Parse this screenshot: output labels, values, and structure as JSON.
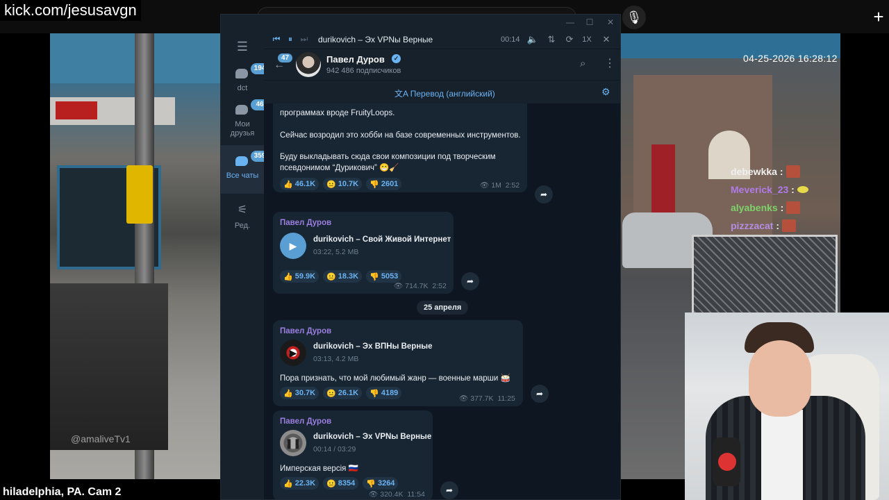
{
  "stream": {
    "url": "kick.com/jesusavgn",
    "cam_timestamp": "04-25-2026 16:28:12",
    "cam_caption": "hiladelphia, PA. Cam 2",
    "watermark": "@amaliveTv1",
    "chat": [
      {
        "user": "debewkka",
        "color": "#f0f0f0"
      },
      {
        "user": "Meverick_23",
        "color": "#b07be8"
      },
      {
        "user": "alyabenks",
        "color": "#7cd36a"
      },
      {
        "user": "pizzzacat",
        "color": "#b28fe3"
      }
    ]
  },
  "telegram": {
    "folders": [
      {
        "label": "dct",
        "badge": "194",
        "active": false
      },
      {
        "label": "Мои друзья",
        "badge": "46",
        "active": false
      },
      {
        "label": "Все чаты",
        "badge": "359",
        "active": true
      },
      {
        "label": "Ред.",
        "badge": "",
        "active": false
      }
    ],
    "player": {
      "title": "durikovich – Эх VPNы Верные",
      "time": "00:14",
      "speed": "1X"
    },
    "channel": {
      "name": "Павел Дуров",
      "subscribers": "942 486 подписчиков",
      "unread": "47"
    },
    "translate_label": "Перевод (английский)",
    "date_separator": "25 апреля",
    "messages": [
      {
        "lines": [
          "программах вроде FruityLoops.",
          "Сейчас возродил это хобби на базе современных инструментов.",
          "Буду выкладывать сюда свои композиции под творческим",
          "псевдонимом “Дурикович” 😁🧹"
        ],
        "reactions": [
          "46.1K",
          "10.7K",
          "2601"
        ],
        "views": "1M",
        "time": "2:52"
      },
      {
        "author": "Павел Дуров",
        "audio_title": "durikovich – Свой Живой Интернет",
        "audio_sub": "03:22, 5.2 MB",
        "reactions": [
          "59.9K",
          "18.3K",
          "5053"
        ],
        "views": "714.7K",
        "time": "2:52"
      },
      {
        "author": "Павел Дуров",
        "audio_title": "durikovich – Эх ВПНы Верные",
        "audio_sub": "03:13, 4.2 MB",
        "text": "Пора признать, что мой любимый жанр — военные марши 🥁",
        "reactions": [
          "30.7K",
          "26.1K",
          "4189"
        ],
        "views": "377.7K",
        "time": "11:25"
      },
      {
        "author": "Павел Дуров",
        "audio_title": "durikovich – Эх VPNы Верные",
        "audio_sub": "00:14 / 03:29",
        "text": "Имперская версія 🇷🇺",
        "reactions": [
          "22.3K",
          "8354",
          "3264"
        ],
        "views": "320.4K",
        "time": "11:54"
      }
    ]
  }
}
